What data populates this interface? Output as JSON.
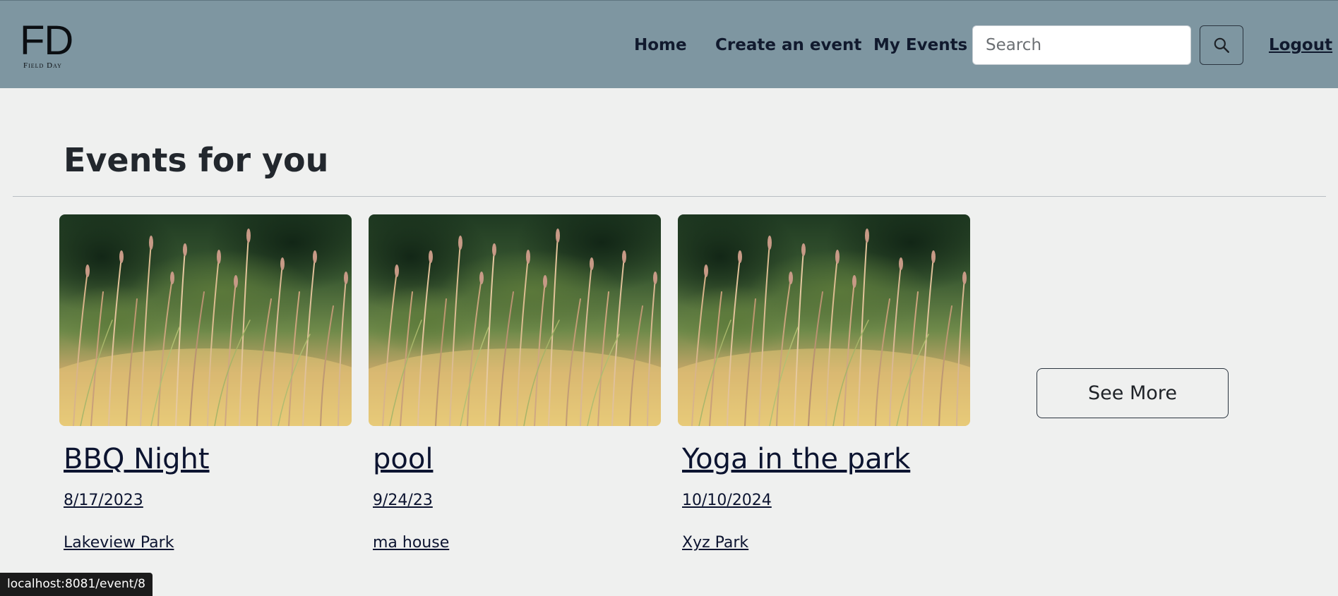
{
  "brand": {
    "logo_big": "FD",
    "logo_small": "Field Day"
  },
  "nav": {
    "home": "Home",
    "create_event": "Create an event",
    "my_events": "My Events",
    "search_placeholder": "Search",
    "search_icon": "search-icon",
    "logout": "Logout"
  },
  "main": {
    "title": "Events for you",
    "see_more": "See More",
    "events": [
      {
        "title": "BBQ Night",
        "date": "8/17/2023",
        "location": "Lakeview Park"
      },
      {
        "title": "pool",
        "date": "9/24/23",
        "location": "ma house"
      },
      {
        "title": "Yoga in the park",
        "date": "10/10/2024",
        "location": "Xyz Park"
      }
    ]
  },
  "status_bar": {
    "url": "localhost:8081/event/8"
  },
  "colors": {
    "navbar": "#7e96a1",
    "background": "#eff0ef",
    "link": "#0c1430"
  }
}
